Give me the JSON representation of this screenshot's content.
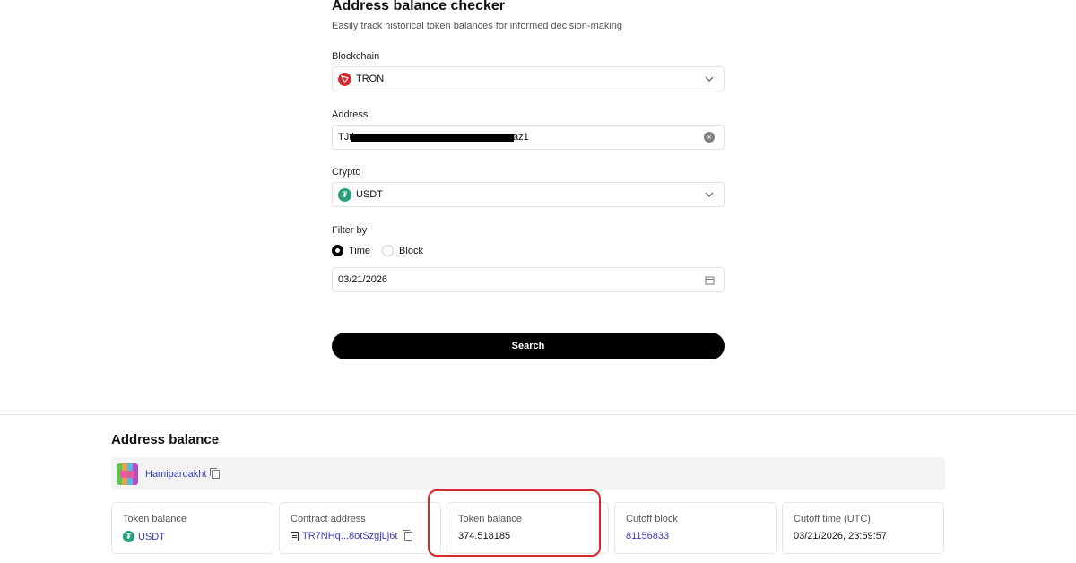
{
  "checker": {
    "title": "Address balance checker",
    "subtitle": "Easily track historical token balances for informed decision-making",
    "blockchain_label": "Blockchain",
    "blockchain_value": "TRON",
    "address_label": "Address",
    "address_prefix": "TJth",
    "address_suffix": "az1",
    "crypto_label": "Crypto",
    "crypto_value": "USDT",
    "filter_label": "Filter by",
    "filter_options": [
      "Time",
      "Block"
    ],
    "filter_selected": "Time",
    "date_value": "03/21/2026",
    "search_label": "Search"
  },
  "result": {
    "title": "Address balance",
    "owner_name": "Hamipardakht",
    "cards": [
      {
        "label": "Token balance",
        "value": "USDT"
      },
      {
        "label": "Contract address",
        "value": "TR7NHq...8otSzgjLj6t"
      },
      {
        "label": "Token balance",
        "value": "374.518185"
      },
      {
        "label": "Cutoff block",
        "value": "81156833"
      },
      {
        "label": "Cutoff time (UTC)",
        "value": "03/21/2026, 23:59:57"
      }
    ]
  },
  "icons": {
    "tron": "tron-logo-icon",
    "usdt": "tether-logo-icon",
    "chevron": "chevron-down-icon",
    "clear": "clear-icon",
    "calendar": "calendar-icon",
    "copy": "copy-icon",
    "contract": "contract-document-icon"
  },
  "colors": {
    "accent_link": "#3b3bb5",
    "tron": "#d8282e",
    "usdt": "#26a17b",
    "highlight": "#d42a2a",
    "button": "#000000"
  }
}
